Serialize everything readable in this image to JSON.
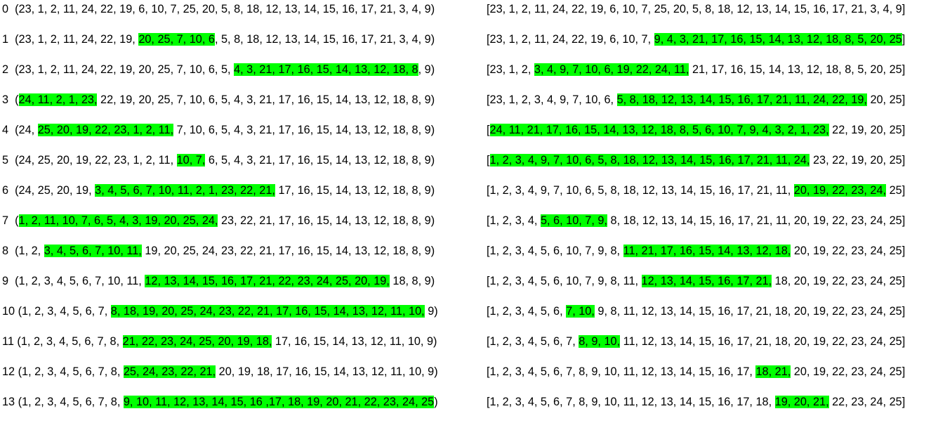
{
  "highlight_color": "#00ff00",
  "left_rows": [
    {
      "pre": "0  (23, 1, 2, 11, 24, 22, 19, 6, 10, 7, 25, 20, 5, 8, 18, 12, 13, 14, 15, 16, 17, 21, 3, 4, 9)",
      "hl": "",
      "post": ""
    },
    {
      "pre": "1  (23, 1, 2, 11, 24, 22, 19, ",
      "hl": "20, 25, 7, 10, 6",
      "post": ", 5, 8, 18, 12, 13, 14, 15, 16, 17, 21, 3, 4, 9)"
    },
    {
      "pre": "2  (23, 1, 2, 11, 24, 22, 19, 20, 25, 7, 10, 6, 5, ",
      "hl": "4, 3, 21, 17, 16, 15, 14, 13, 12, 18, 8",
      "post": ", 9)"
    },
    {
      "pre": "3  (",
      "hl": "24, 11, 2, 1, 23,",
      "post": " 22, 19, 20, 25, 7, 10, 6, 5, 4, 3, 21, 17, 16, 15, 14, 13, 12, 18, 8, 9)"
    },
    {
      "pre": "4  (24, ",
      "hl": "25, 20, 19, 22, 23, 1, 2, 11,",
      "post": " 7, 10, 6, 5, 4, 3, 21, 17, 16, 15, 14, 13, 12, 18, 8, 9)"
    },
    {
      "pre": "5  (24, 25, 20, 19, 22, 23, 1, 2, 11, ",
      "hl": "10, 7,",
      "post": " 6, 5, 4, 3, 21, 17, 16, 15, 14, 13, 12, 18, 8, 9)"
    },
    {
      "pre": "6  (24, 25, 20, 19, ",
      "hl": "3, 4, 5, 6, 7, 10, 11, 2, 1, 23, 22, 21,",
      "post": " 17, 16, 15, 14, 13, 12, 18, 8, 9)"
    },
    {
      "pre": "7  (",
      "hl": "1, 2, 11, 10, 7, 6, 5, 4, 3, 19, 20, 25, 24,",
      "post": " 23, 22, 21, 17, 16, 15, 14, 13, 12, 18, 8, 9)"
    },
    {
      "pre": "8  (1, 2, ",
      "hl": "3, 4, 5, 6, 7, 10, 11,",
      "post": " 19, 20, 25, 24, 23, 22, 21, 17, 16, 15, 14, 13, 12, 18, 8, 9)"
    },
    {
      "pre": "9  (1, 2, 3, 4, 5, 6, 7, 10, 11, ",
      "hl": "12, 13, 14, 15, 16, 17, 21, 22, 23, 24, 25, 20, 19,",
      "post": " 18, 8, 9)"
    },
    {
      "pre": "10 (1, 2, 3, 4, 5, 6, 7, ",
      "hl": "8, 18, 19, 20, 25, 24, 23, 22, 21, 17, 16, 15, 14, 13, 12, 11, 10,",
      "post": " 9)"
    },
    {
      "pre": "11 (1, 2, 3, 4, 5, 6, 7, 8, ",
      "hl": "21, 22, 23, 24, 25, 20, 19, 18,",
      "post": " 17, 16, 15, 14, 13, 12, 11, 10, 9)"
    },
    {
      "pre": "12 (1, 2, 3, 4, 5, 6, 7, 8, ",
      "hl": "25, 24, 23, 22, 21,",
      "post": " 20, 19, 18, 17, 16, 15, 14, 13, 12, 11, 10, 9)"
    },
    {
      "pre": "13 (1, 2, 3, 4, 5, 6, 7, 8, ",
      "hl": "9, 10, 11, 12, 13, 14, 15, 16 ,17, 18, 19, 20, 21, 22, 23, 24, 25",
      "post": ")"
    }
  ],
  "right_rows": [
    {
      "pre": "[23, 1, 2, 11, 24, 22, 19, 6, 10, 7, 25, 20, 5, 8, 18, 12, 13, 14, 15, 16, 17, 21, 3, 4, 9]",
      "hl": "",
      "post": ""
    },
    {
      "pre": "[23, 1, 2, 11, 24, 22, 19, 6, 10, 7, ",
      "hl": "9, 4, 3, 21, 17, 16, 15, 14, 13, 12, 18, 8, 5, 20, 25",
      "post": "]"
    },
    {
      "pre": "[23, 1, 2, ",
      "hl": "3, 4, 9, 7, 10, 6, 19, 22, 24, 11,",
      "post": " 21, 17, 16, 15, 14, 13, 12, 18, 8, 5, 20, 25]"
    },
    {
      "pre": "[23, 1, 2, 3, 4, 9, 7, 10, 6, ",
      "hl": "5, 8, 18, 12, 13, 14, 15, 16, 17, 21, 11, 24, 22, 19,",
      "post": " 20, 25]"
    },
    {
      "pre": "[",
      "hl": "24, 11, 21, 17, 16, 15, 14, 13, 12, 18, 8, 5, 6, 10, 7, 9, 4, 3, 2, 1, 23,",
      "post": " 22, 19, 20, 25]"
    },
    {
      "pre": "[",
      "hl": "1, 2, 3, 4, 9, 7, 10, 6, 5, 8, 18, 12, 13, 14, 15, 16, 17, 21, 11, 24,",
      "post": " 23, 22, 19, 20, 25]"
    },
    {
      "pre": "[1, 2, 3, 4, 9, 7, 10, 6, 5, 8, 18, 12, 13, 14, 15, 16, 17, 21, 11, ",
      "hl": "20, 19, 22, 23, 24,",
      "post": " 25]"
    },
    {
      "pre": "[1, 2, 3, 4, ",
      "hl": "5, 6, 10, 7, 9,",
      "post": " 8, 18, 12, 13, 14, 15, 16, 17, 21, 11, 20, 19, 22, 23, 24, 25]"
    },
    {
      "pre": "[1, 2, 3, 4, 5, 6, 10, 7, 9, 8, ",
      "hl": "11, 21, 17, 16, 15, 14, 13, 12, 18,",
      "post": " 20, 19, 22, 23, 24, 25]"
    },
    {
      "pre": "[1, 2, 3, 4, 5, 6, 10, 7, 9, 8, 11, ",
      "hl": "12, 13, 14, 15, 16, 17, 21,",
      "post": " 18, 20, 19, 22, 23, 24, 25]"
    },
    {
      "pre": "[1, 2, 3, 4, 5, 6, ",
      "hl": "7, 10,",
      "post": " 9, 8, 11, 12, 13, 14, 15, 16, 17, 21, 18, 20, 19, 22, 23, 24, 25]"
    },
    {
      "pre": "[1, 2, 3, 4, 5, 6, 7, ",
      "hl": "8, 9, 10,",
      "post": " 11, 12, 13, 14, 15, 16, 17, 21, 18, 20, 19, 22, 23, 24, 25]"
    },
    {
      "pre": "[1, 2, 3, 4, 5, 6, 7, 8, 9, 10, 11, 12, 13, 14, 15, 16, 17, ",
      "hl": "18, 21,",
      "post": " 20, 19, 22, 23, 24, 25]"
    },
    {
      "pre": "[1, 2, 3, 4, 5, 6, 7, 8, 9, 10, 11, 12, 13, 14, 15, 16, 17, 18, ",
      "hl": "19, 20, 21,",
      "post": " 22, 23, 24, 25]"
    }
  ]
}
